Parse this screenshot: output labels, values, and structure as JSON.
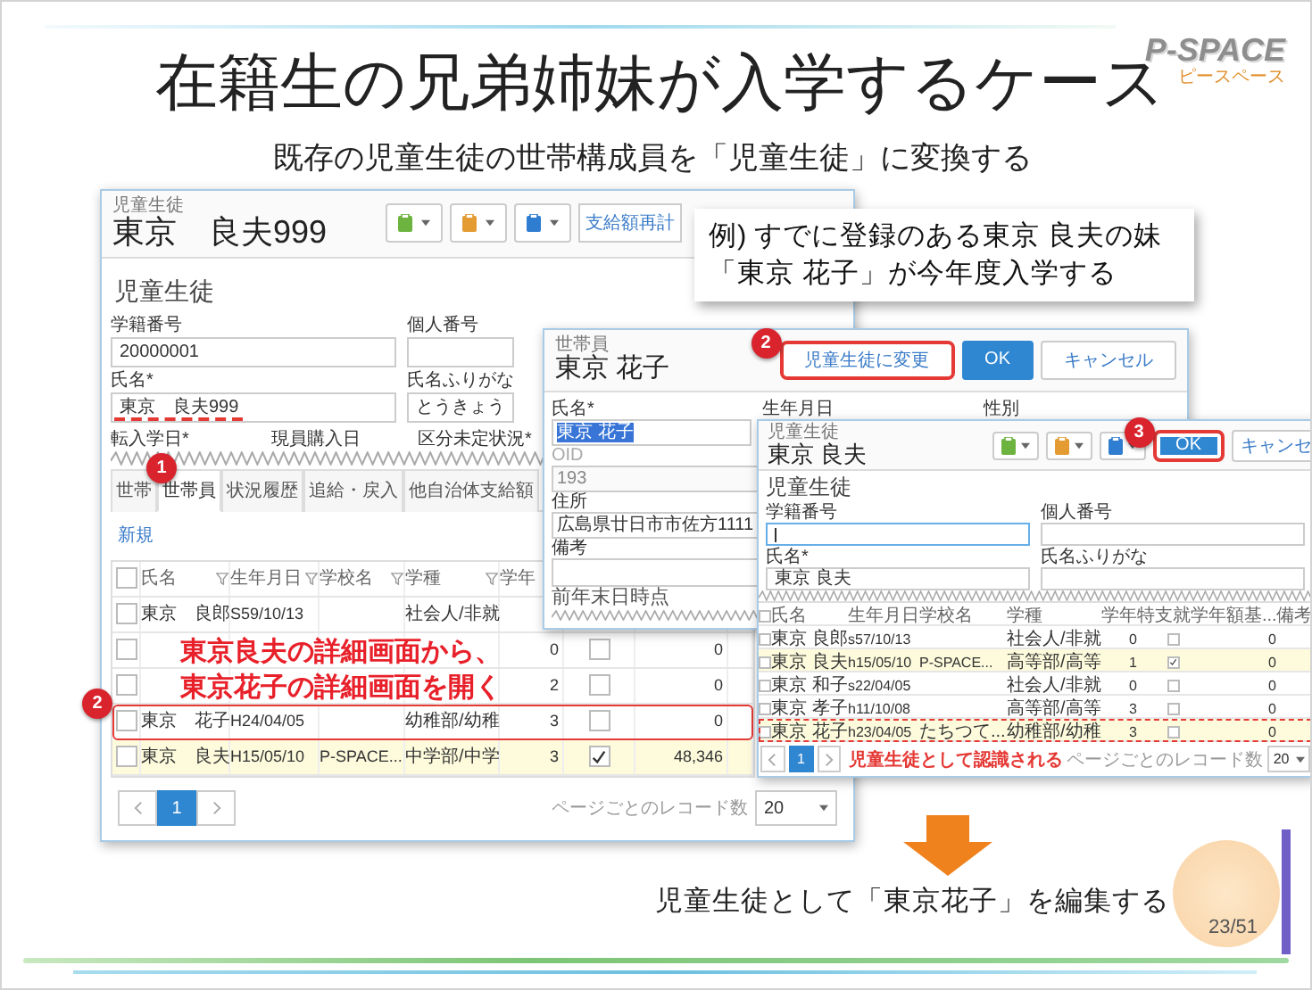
{
  "slide": {
    "title": "在籍生の兄弟姉妹が入学するケース",
    "subtitle": "既存の児童生徒の世帯構成員を「児童生徒」に変換する",
    "logo": "P-SPACE",
    "logo_kana": "ピースペース",
    "footer": "児童生徒として「東京花子」を編集する",
    "page": "23/51"
  },
  "callout": [
    "例) すでに登録のある東京 良夫の妹",
    "「東京 花子」が今年度入学する"
  ],
  "student_window": {
    "caption": "児童生徒",
    "name": "東京　良夫999",
    "toolbar": [
      {
        "color": "#6cb33f"
      },
      {
        "color": "#e39b32"
      },
      {
        "color": "#2f7dd1"
      }
    ],
    "action": "支給額再計",
    "section": "児童生徒",
    "fields": [
      {
        "label": "学籍番号",
        "value": "20000001",
        "underlined": false
      },
      {
        "label": "個人番号",
        "underlined": false
      },
      {
        "label": "氏名*",
        "value": "東京　良夫999",
        "underlined": true
      },
      {
        "label": "氏名ふりがな",
        "value": "とうきょう",
        "underlined": false
      }
    ],
    "cut_labels": [
      "転入学日*",
      "現員購入日",
      "区分未定状況*"
    ],
    "tabs": [
      {
        "label": "世帯",
        "selected": false
      },
      {
        "label": "世帯員",
        "selected": true,
        "badge": "1"
      },
      {
        "label": "状況履歴",
        "selected": false
      },
      {
        "label": "追給・戻入",
        "selected": false
      },
      {
        "label": "他自治体支給額",
        "selected": false
      }
    ],
    "new_link": "新規",
    "all_selected": false,
    "columns": [
      {
        "label": "氏名",
        "filter": true
      },
      {
        "label": "生年月日",
        "filter": true
      },
      {
        "label": "学校名",
        "filter": true
      },
      {
        "label": "学種",
        "filter": true
      },
      {
        "label": "学年"
      }
    ],
    "rows": [
      {
        "name": "東京　良郎",
        "birth": "S59/10/13",
        "type": "社会人/非就",
        "selected": false,
        "highlighted": false,
        "outlined": false
      },
      {
        "grade": "0",
        "checked": false,
        "amount": "0",
        "selected": false,
        "highlighted": false,
        "outlined": false
      },
      {
        "grade": "2",
        "checked": false,
        "amount": "0",
        "selected": false,
        "highlighted": false,
        "outlined": false
      },
      {
        "name": "東京　花子",
        "birth": "H24/04/05",
        "type": "幼稚部/幼稚",
        "grade": "3",
        "checked": false,
        "amount": "0",
        "selected": false,
        "highlighted": false,
        "outlined": true,
        "badge": "2"
      },
      {
        "name": "東京　良夫",
        "birth": "H15/05/10",
        "school": "P-SPACE...",
        "type": "中学部/中学",
        "grade": "3",
        "checked": true,
        "amount": "48,346",
        "selected": false,
        "highlighted": true,
        "outlined": false
      }
    ],
    "pager": {
      "page": "1",
      "page_size_label": "ページごとのレコード数",
      "page_size": "20"
    },
    "note": [
      "東京良夫の詳細画面から、",
      "東京花子の詳細画面を開く"
    ]
  },
  "member_window": {
    "caption": "世帯員",
    "name": "東京 花子",
    "badge": "2",
    "buttons": [
      {
        "label": "児童生徒に変更",
        "kind": "default",
        "ringed": true
      },
      {
        "label": "OK",
        "kind": "primary",
        "ringed": false
      },
      {
        "label": "キャンセル",
        "kind": "default",
        "ringed": false
      }
    ],
    "top_fields": [
      {
        "label": "氏名*",
        "value": "東京 花子",
        "kind": "selected-text"
      },
      {
        "label": "生年月日",
        "kind": "label"
      },
      {
        "label": "性別",
        "kind": "label"
      }
    ],
    "fields": [
      {
        "label": "OID",
        "value": "193",
        "kind": "disabled"
      },
      {
        "label": "住所",
        "value": "広島県廿日市市佐方1111",
        "kind": "text"
      },
      {
        "label": "備考",
        "kind": "textarea"
      }
    ],
    "subsection": "前年末日時点"
  },
  "student_dialog": {
    "caption": "児童生徒",
    "name": "東京 良夫",
    "toolbar": [
      {
        "color": "#6cb33f"
      },
      {
        "color": "#e39b32"
      },
      {
        "color": "#2f7dd1"
      }
    ],
    "badge": "3",
    "buttons": [
      {
        "label": "OK",
        "kind": "primary",
        "ringed": true
      },
      {
        "label": "キャンセ",
        "kind": "cut",
        "ringed": false
      }
    ],
    "section": "児童生徒",
    "fields": [
      {
        "label": "学籍番号",
        "focused": true
      },
      {
        "label": "個人番号",
        "focused": false
      },
      {
        "label": "氏名*",
        "value": "東京 良夫",
        "focused": false
      },
      {
        "label": "氏名ふりがな",
        "focused": false
      }
    ],
    "all_selected": false,
    "columns": [
      {
        "label": "氏名"
      },
      {
        "label": "生年月日"
      },
      {
        "label": "学校名"
      },
      {
        "label": "学種"
      },
      {
        "label": "学年"
      },
      {
        "label": "特支就学"
      },
      {
        "label": "年額基..."
      },
      {
        "label": "備考"
      }
    ],
    "rows": [
      {
        "name": "東京 良郎",
        "birth": "s57/10/13",
        "type": "社会人/非就",
        "grade": "0",
        "checked": false,
        "amount": "0",
        "selected": false,
        "highlighted": false,
        "outlined": false
      },
      {
        "name": "東京 良夫",
        "birth": "h15/05/10",
        "school": "P-SPACE...",
        "type": "高等部/高等",
        "grade": "1",
        "checked": true,
        "amount": "0",
        "selected": false,
        "highlighted": true,
        "outlined": false
      },
      {
        "name": "東京 和子",
        "birth": "s22/04/05",
        "type": "社会人/非就",
        "grade": "0",
        "checked": false,
        "amount": "0",
        "selected": false,
        "highlighted": false,
        "outlined": false
      },
      {
        "name": "東京 孝子",
        "birth": "h11/10/08",
        "type": "高等部/高等",
        "grade": "3",
        "checked": false,
        "amount": "0",
        "selected": false,
        "highlighted": false,
        "outlined": false
      },
      {
        "name": "東京 花子",
        "birth": "h23/04/05",
        "school": "たちつて...",
        "type": "幼稚部/幼稚",
        "grade": "3",
        "checked": false,
        "amount": "0",
        "selected": false,
        "highlighted": true,
        "outlined": true
      }
    ],
    "note": "児童生徒として認識される",
    "pager": {
      "page": "1",
      "page_size_label": "ページごとのレコード数",
      "page_size": "20"
    }
  }
}
